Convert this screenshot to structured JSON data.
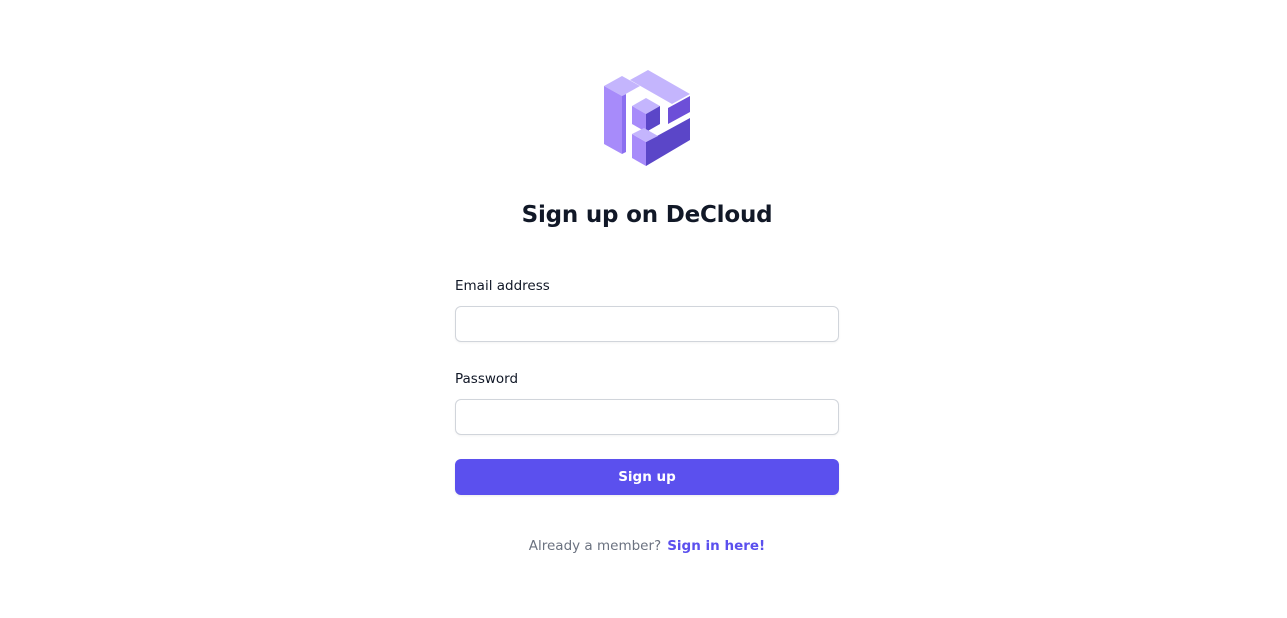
{
  "brand": {
    "logo_icon": "decloud-cube-logo-icon",
    "colors": {
      "light": "#c4b5fd",
      "mid": "#a78bfa",
      "dark": "#6d28d9",
      "deep": "#5b46c8"
    }
  },
  "heading": {
    "title": "Sign up on DeCloud"
  },
  "form": {
    "email": {
      "label": "Email address",
      "value": "",
      "placeholder": ""
    },
    "password": {
      "label": "Password",
      "value": "",
      "placeholder": ""
    },
    "submit_label": "Sign up"
  },
  "footer": {
    "prompt": "Already a member?",
    "link_text": "Sign in here!"
  },
  "theme": {
    "accent": "#5b50ee",
    "text": "#111827",
    "muted": "#6b7280",
    "border": "#d1d5db"
  }
}
